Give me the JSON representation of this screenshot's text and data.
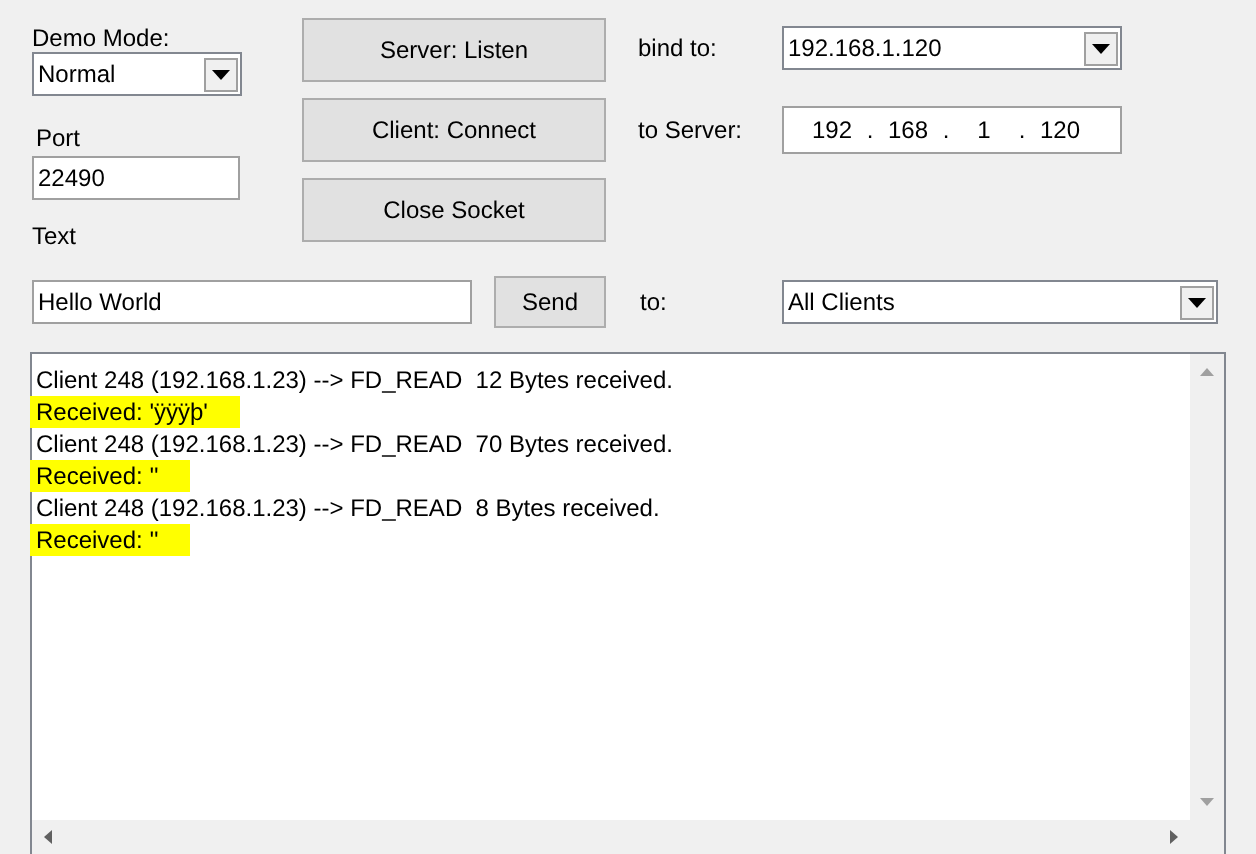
{
  "demo_mode": {
    "label": "Demo Mode:",
    "value": "Normal"
  },
  "port": {
    "label": "Port",
    "value": "22490"
  },
  "text": {
    "label": "Text",
    "value": "Hello World"
  },
  "buttons": [
    "Server: Listen",
    "Client: Connect",
    "Close Socket"
  ],
  "send_button": "Send",
  "bind_to": {
    "label": "bind to:",
    "value": "192.168.1.120"
  },
  "to_server": {
    "label": "to Server:",
    "octets": [
      "192",
      "168",
      "1",
      "120"
    ],
    "separator": "."
  },
  "to": {
    "label": "to:",
    "value": "All Clients"
  },
  "log": [
    {
      "text": "Client 248 (192.168.1.23) --> FD_READ  12 Bytes received.",
      "highlighted": false
    },
    {
      "text": "Received: 'ÿÿÿþ'",
      "highlighted": true
    },
    {
      "text": "Client 248 (192.168.1.23) --> FD_READ  70 Bytes received.",
      "highlighted": false
    },
    {
      "text": "Received: ''",
      "highlighted": true
    },
    {
      "text": "Client 248 (192.168.1.23) --> FD_READ  8 Bytes received.",
      "highlighted": false
    },
    {
      "text": "Received: ''",
      "highlighted": true
    }
  ]
}
